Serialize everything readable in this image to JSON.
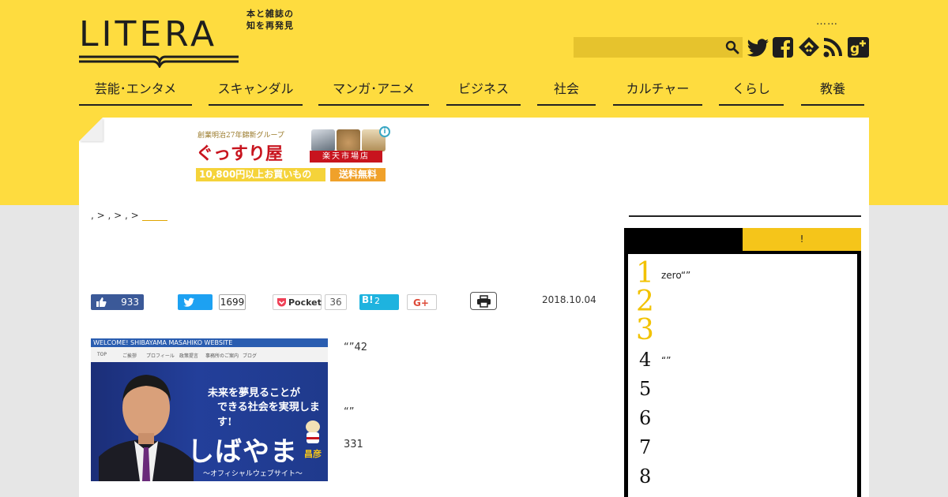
{
  "header": {
    "logo_text": "LITERA",
    "tagline": "本と雑誌の知を再発見",
    "dots": "……",
    "search_placeholder": "",
    "social": [
      "twitter-icon",
      "facebook-icon",
      "feedly-icon",
      "rss-icon",
      "googleplus-icon"
    ]
  },
  "nav": [
    "芸能･エンタメ",
    "スキャンダル",
    "マンガ･アニメ",
    "ビジネス",
    "社会",
    "カルチャー",
    "くらし",
    "教養"
  ],
  "ad": {
    "small": "創業明治27年錦新グループ",
    "shop": "ぐっすり屋",
    "badge": "楽天市場店",
    "bar1": "10,800円以上お買いもの",
    "bar2": "送料無料",
    "info": "i"
  },
  "breadcrumb": {
    "sep1": ", > ",
    "sep2": ", > ",
    "sep3": ", > "
  },
  "share": {
    "fb_count": "933",
    "tw_count": "1699",
    "pocket_label": "Pocket",
    "pocket_count": "36",
    "hatena_label": "B!",
    "hatena_count": "2",
    "gplus_label": "G+"
  },
  "date": "2018.10.04",
  "article": {
    "image_banner": "WELCOME! SHIBAYAMA MASAHIKO WEBSITE",
    "image_nav": [
      "TOP",
      "ご挨拶",
      "プロフィール",
      "政策提言",
      "事務所のご案内",
      "ブログ"
    ],
    "image_slogan1": "未来を夢見ることが",
    "image_slogan2": "できる社会を実現します!",
    "image_name": "しばやま",
    "image_name_small": "昌彦",
    "image_sub": "〜オフィシャルウェブサイト〜",
    "p1": "“”42",
    "p2": "“”",
    "p3": "331"
  },
  "sidebar": {
    "tab2": "!",
    "ranking": [
      {
        "num": "1",
        "text": "zero“”"
      },
      {
        "num": "2",
        "text": ""
      },
      {
        "num": "3",
        "text": ""
      },
      {
        "num": "4",
        "text": "“”"
      },
      {
        "num": "5",
        "text": ""
      },
      {
        "num": "6",
        "text": ""
      },
      {
        "num": "7",
        "text": ""
      },
      {
        "num": "8",
        "text": ""
      }
    ]
  },
  "colors": {
    "brand_yellow": "#fedc3f",
    "rank_gold": "#f2c200",
    "background": "#e6e6e6"
  }
}
